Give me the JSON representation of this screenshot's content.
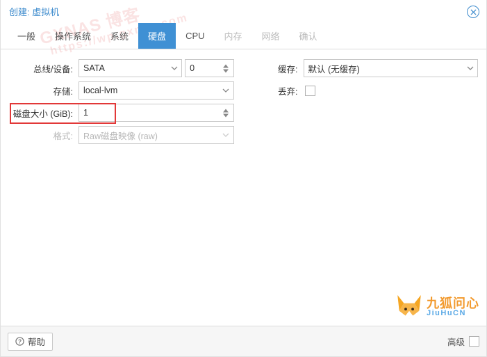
{
  "title": "创建: 虚拟机",
  "tabs": {
    "general": "一般",
    "os": "操作系统",
    "system": "系统",
    "disk": "硬盘",
    "cpu": "CPU",
    "memory": "内存",
    "network": "网络",
    "confirm": "确认"
  },
  "left": {
    "busdev_label": "总线/设备:",
    "busdev_value": "SATA",
    "busdev_index": "0",
    "storage_label": "存储:",
    "storage_value": "local-lvm",
    "size_label": "磁盘大小 (GiB):",
    "size_value": "1",
    "format_label": "格式:",
    "format_value": "Raw磁盘映像 (raw)"
  },
  "right": {
    "cache_label": "缓存:",
    "cache_value": "默认 (无缓存)",
    "discard_label": "丢弃:"
  },
  "footer": {
    "help": "帮助",
    "advanced": "高级"
  },
  "watermark_line1": "GXNAS 博客",
  "watermark_line2": "https://wp.gxnas.com",
  "brand_zh": "九狐问心",
  "brand_py": "JiuHuCN"
}
